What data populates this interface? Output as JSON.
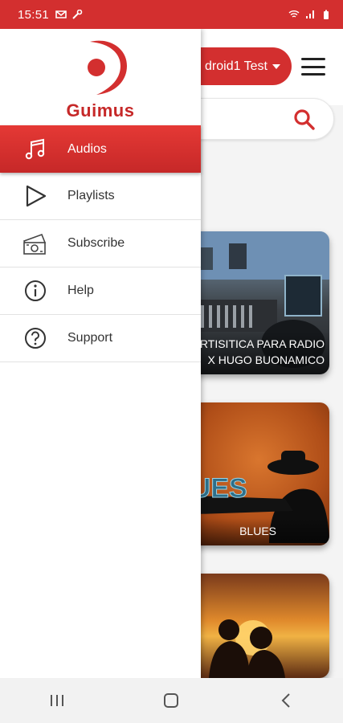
{
  "status_bar": {
    "time": "15:51",
    "left_icons": [
      "mail-icon",
      "wrench-icon"
    ],
    "right_icons": [
      "wifi-icon",
      "signal-icon",
      "battery-icon"
    ]
  },
  "drawer": {
    "brand": "Guimus",
    "items": [
      {
        "label": "Audios",
        "icon": "music-note-icon",
        "active": true
      },
      {
        "label": "Playlists",
        "icon": "play-outline-icon",
        "active": false
      },
      {
        "label": "Subscribe",
        "icon": "money-icon",
        "active": false
      },
      {
        "label": "Help",
        "icon": "info-icon",
        "active": false
      },
      {
        "label": "Support",
        "icon": "question-icon",
        "active": false
      }
    ]
  },
  "header": {
    "account_label": "droid1 Test",
    "menu_icon": "hamburger-icon",
    "search_icon": "search-icon"
  },
  "cards": [
    {
      "caption_line1": "RTISITICA PARA RADIO",
      "caption_line2": "X HUGO BUONAMICO"
    },
    {
      "caption_line1": "BLUES"
    },
    {
      "caption_line1": ""
    }
  ],
  "colors": {
    "brand_red": "#d32f2f",
    "drawer_active": "#c62828"
  },
  "system_nav": [
    "recents-icon",
    "home-icon",
    "back-icon"
  ]
}
